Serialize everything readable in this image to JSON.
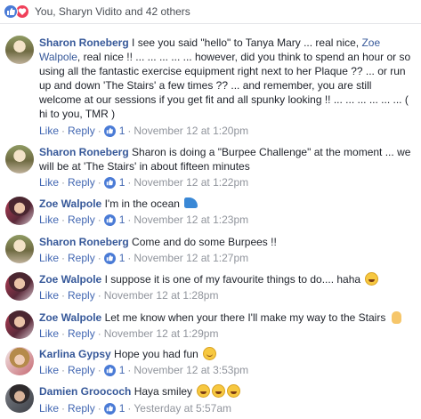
{
  "reactions": {
    "summary": "You, Sharyn Vidito and 42 others"
  },
  "actions": {
    "like": "Like",
    "reply": "Reply",
    "separator": "·"
  },
  "comments": [
    {
      "name": "Sharon Roneberg",
      "text_before": "I see you said \"hello\" to Tanya Mary ... real nice,",
      "tag": "Zoe Walpole",
      "text_after": ", real nice !! ... ... ... ... ... however, did you think to spend an hour or so using all the fantastic exercise equipment right next to her Plaque ?? ... or run up and down 'The Stairs' a few times ?? ... and remember, you are still welcome at our sessions if you get fit and all spunky looking !! ... ... ... ... ... ... ( hi to you, TMR )",
      "likes": "1",
      "time": "November 12 at 1:20pm"
    },
    {
      "name": "Sharon Roneberg",
      "text": "Sharon is doing a \"Burpee Challenge\" at the moment ... we will be at 'The Stairs' in about fifteen minutes",
      "likes": "1",
      "time": "November 12 at 1:22pm"
    },
    {
      "name": "Zoe Walpole",
      "text": "I'm in the ocean",
      "emoji": "wave-icon",
      "likes": "1",
      "time": "November 12 at 1:23pm"
    },
    {
      "name": "Sharon Roneberg",
      "text": "Come and do some Burpees !!",
      "likes": "1",
      "time": "November 12 at 1:27pm"
    },
    {
      "name": "Zoe Walpole",
      "text": "I suppose it is one of my favourite things to do.... haha",
      "emoji": "laughing-emoji",
      "time": "November 12 at 1:28pm"
    },
    {
      "name": "Zoe Walpole",
      "text": "Let me know when your there I'll make my way to the Stairs",
      "emoji": "hand-icon",
      "time": "November 12 at 1:29pm"
    },
    {
      "name": "Karlina Gypsy",
      "text": "Hope you had fun",
      "emoji": "smile-emoji",
      "likes": "1",
      "time": "November 12 at 3:53pm"
    },
    {
      "name": "Damien Groococh",
      "text": "Haya smiley",
      "emoji": "grin-emoji",
      "likes": "1",
      "time": "Yesterday at 5:57am"
    }
  ]
}
